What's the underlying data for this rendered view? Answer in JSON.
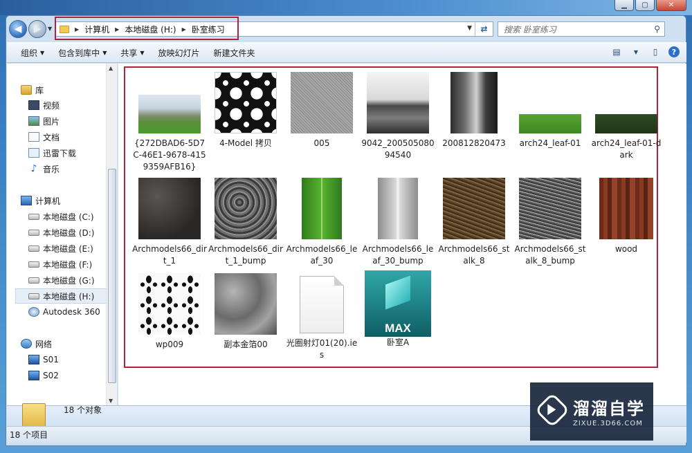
{
  "window": {
    "caption": {
      "minimize": "▁",
      "maximize": "▢",
      "close": "✕"
    }
  },
  "address": {
    "breadcrumbs": [
      "计算机",
      "本地磁盘 (H:)",
      "卧室练习"
    ],
    "search_placeholder": "搜索 卧室练习"
  },
  "toolbar": {
    "organize": "组织",
    "include_in_library": "包含到库中",
    "share": "共享",
    "slideshow": "放映幻灯片",
    "new_folder": "新建文件夹"
  },
  "sidebar": {
    "libraries": {
      "label": "库",
      "items": [
        "视频",
        "图片",
        "文档",
        "迅雷下载",
        "音乐"
      ]
    },
    "computer": {
      "label": "计算机",
      "items": [
        "本地磁盘 (C:)",
        "本地磁盘 (D:)",
        "本地磁盘 (E:)",
        "本地磁盘 (F:)",
        "本地磁盘 (G:)",
        "本地磁盘 (H:)",
        "Autodesk 360"
      ],
      "selected": "本地磁盘 (H:)"
    },
    "network": {
      "label": "网络",
      "items": [
        "S01",
        "S02"
      ]
    }
  },
  "files": [
    {
      "name": "{272DBAD6-5D7C-46E1-9678-4159359AFB16}",
      "thumb": "photo"
    },
    {
      "name": "4-Model 拷贝",
      "thumb": "pattern"
    },
    {
      "name": "005",
      "thumb": "noise"
    },
    {
      "name": "9042_20050508094540",
      "thumb": "city"
    },
    {
      "name": "200812820473",
      "thumb": "street"
    },
    {
      "name": "arch24_leaf-01",
      "thumb": "grass"
    },
    {
      "name": "arch24_leaf-01-dark",
      "thumb": "grass-dark"
    },
    {
      "name": "Archmodels66_dirt_1",
      "thumb": "dirt"
    },
    {
      "name": "Archmodels66_dirt_1_bump",
      "thumb": "dirt-bump"
    },
    {
      "name": "Archmodels66_leaf_30",
      "thumb": "leaf"
    },
    {
      "name": "Archmodels66_leaf_30_bump",
      "thumb": "leaf-bump"
    },
    {
      "name": "Archmodels66_stalk_8",
      "thumb": "stalk"
    },
    {
      "name": "Archmodels66_stalk_8_bump",
      "thumb": "stalk-bump"
    },
    {
      "name": "wood",
      "thumb": "wood"
    },
    {
      "name": "wp009",
      "thumb": "damask"
    },
    {
      "name": "副本金箔00",
      "thumb": "gold"
    },
    {
      "name": "光圈射灯01(20).ies",
      "thumb": "blank-file"
    },
    {
      "name": "卧室A",
      "thumb": "max-file"
    }
  ],
  "max_badge": "MAX",
  "details": {
    "count_text": "18 个对象"
  },
  "status": {
    "count_text": "18 个项目"
  },
  "watermark": {
    "title": "溜溜自学",
    "url": "ZIXUE.3D66.COM"
  }
}
